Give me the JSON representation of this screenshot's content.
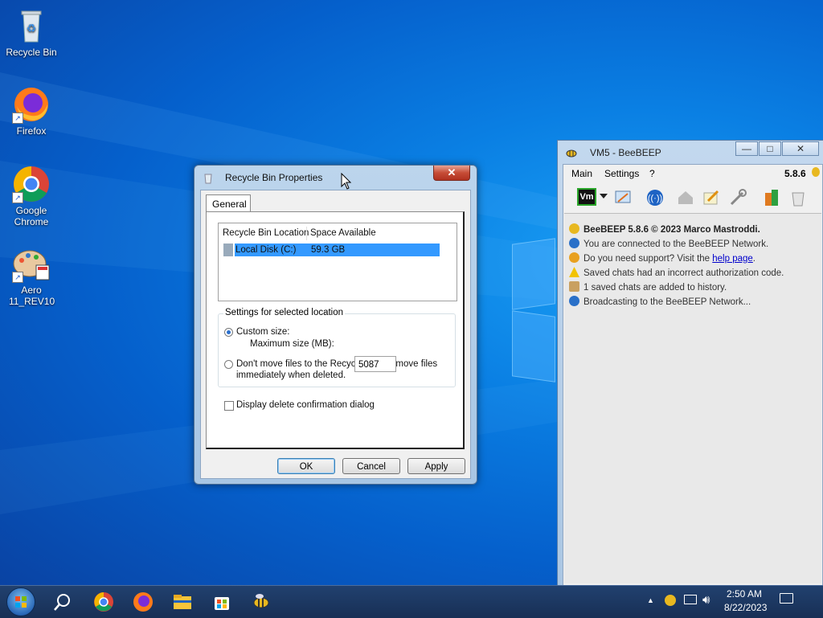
{
  "desktop": {
    "icons": [
      {
        "label": "Recycle Bin"
      },
      {
        "label": "Firefox"
      },
      {
        "label": "Google Chrome"
      },
      {
        "label": "Aero 11_REV10"
      }
    ]
  },
  "dialog": {
    "title": "Recycle Bin Properties",
    "close_glyph": "✕",
    "tab_label": "General",
    "list_headers": [
      "Recycle Bin Location",
      "Space Available"
    ],
    "list_rows": [
      {
        "location": "Local Disk (C:)",
        "space": "59.3 GB",
        "selected": true
      }
    ],
    "settings_group_label": "Settings for selected location",
    "custom_size_label": "Custom size:",
    "custom_size_selected": true,
    "max_size_label": "Maximum size (MB):",
    "max_size_value": "5087",
    "dont_move_label_line1": "Don't move files to the Recycle Bin. Remove files",
    "dont_move_label_line2": "immediately when deleted.",
    "dont_move_selected": false,
    "confirm_label": "Display delete confirmation dialog",
    "confirm_checked": false,
    "ok_label": "OK",
    "cancel_label": "Cancel",
    "apply_label": "Apply"
  },
  "beebeep": {
    "title": "VM5 - BeeBEEP",
    "minimize_glyph": "—",
    "maximize_glyph": "□",
    "close_glyph": "✕",
    "menu": [
      "Main",
      "Settings",
      "?"
    ],
    "version": "5.8.6",
    "toolbar_status": "Vm",
    "log": [
      {
        "icon": "bee-icon",
        "text": "BeeBEEP 5.8.6 © 2023 Marco Mastroddi.",
        "bold": true
      },
      {
        "icon": "network-icon",
        "text": "You are connected to the BeeBEEP Network."
      },
      {
        "icon": "support-icon",
        "text": "Do you need support? Visit the ",
        "link": "help page",
        "suffix": "."
      },
      {
        "icon": "warning-icon",
        "text": "Saved chats had an incorrect authorization code."
      },
      {
        "icon": "history-icon",
        "text": "1 saved chats are added to history."
      },
      {
        "icon": "broadcast-icon",
        "text": "Broadcasting to the BeeBEEP Network..."
      }
    ]
  },
  "taskbar": {
    "time": "2:50 AM",
    "date": "8/22/2023",
    "tray_arrow": "▲"
  },
  "colors": {
    "accent": "#3399ff",
    "desktop": "#0a7fe3",
    "taskbar": "#1d3a66"
  }
}
